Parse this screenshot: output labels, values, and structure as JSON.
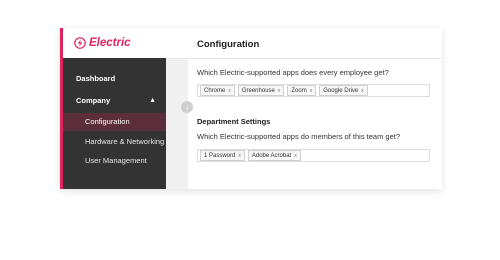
{
  "brand": {
    "name": "Electric",
    "accent_color": "#e0245e",
    "sidebar_color": "#333333"
  },
  "sidebar": {
    "items": [
      {
        "label": "Dashboard"
      },
      {
        "label": "Company",
        "chevron": "chevron-up-icon"
      },
      {
        "label": "Configuration",
        "active": true
      },
      {
        "label": "Hardware & Networking"
      },
      {
        "label": "User Management"
      }
    ]
  },
  "main": {
    "title": "Configuration",
    "everyone_question": "Which Electric-supported apps does every employee get?",
    "everyone_apps": [
      "Chrome",
      "Greenhouse",
      "Zoom",
      "Google Drive"
    ],
    "department_heading": "Department Settings",
    "team_question": "Which Electric-supported apps do members of this team get?",
    "team_apps": [
      "1 Password",
      "Adobe Acrobat"
    ],
    "remove_glyph": "x"
  }
}
